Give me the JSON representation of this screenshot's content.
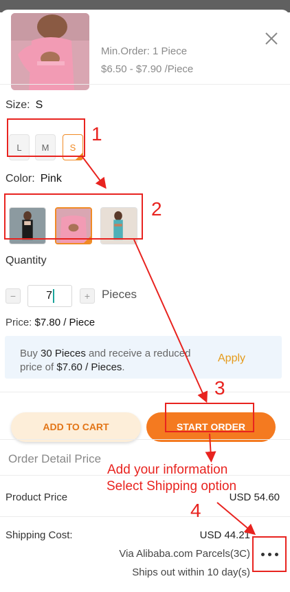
{
  "product": {
    "min_order": "Min.Order: 1 Piece",
    "price_range": "$6.50 - $7.90 /Piece"
  },
  "size": {
    "label": "Size:",
    "selected": "S",
    "options": [
      "L",
      "M",
      "S"
    ]
  },
  "color": {
    "label": "Color:",
    "selected": "Pink",
    "swatches": [
      "black-outfit",
      "pink-outfit",
      "blue-outfit"
    ]
  },
  "quantity": {
    "label": "Quantity",
    "value": "7",
    "minus": "−",
    "plus": "+",
    "unit": "Pieces"
  },
  "unit_price": {
    "label": "Price:",
    "value": "$7.80 / Piece"
  },
  "promo": {
    "text_a": "Buy ",
    "qty": "30 Pieces",
    "text_b": " and receive a reduced price of ",
    "price": "$7.60 / Pieces",
    "text_c": ".",
    "apply": "Apply"
  },
  "actions": {
    "add_to_cart": "ADD TO CART",
    "start_order": "START ORDER"
  },
  "order_detail": {
    "title": "Order Detail Price",
    "product_price_label": "Product Price",
    "product_price_value": "USD 54.60",
    "shipping_label": "Shipping Cost:",
    "shipping_value": "USD 44.21",
    "shipping_method": "Via Alibaba.com Parcels(3C)",
    "ships_out": "Ships out within 10 day(s)"
  },
  "annotations": {
    "step1": "1",
    "step2": "2",
    "step3": "3",
    "step4": "4",
    "note_line1": "Add your information",
    "note_line2": "Select Shipping option"
  },
  "colors": {
    "accent": "#f47a20",
    "annotation": "#e8231f",
    "promo_bg": "#eef5fc"
  },
  "icons": {
    "close": "close-icon",
    "more": "more-dots-icon"
  }
}
